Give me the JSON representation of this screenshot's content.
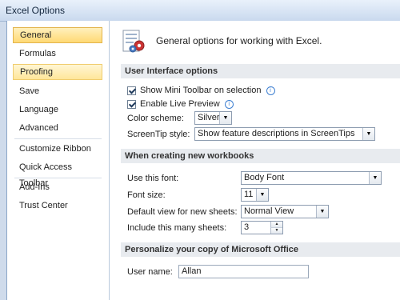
{
  "window": {
    "title": "Excel Options"
  },
  "sidebar": {
    "items": [
      {
        "label": "General"
      },
      {
        "label": "Formulas"
      },
      {
        "label": "Proofing"
      },
      {
        "label": "Save"
      },
      {
        "label": "Language"
      },
      {
        "label": "Advanced"
      },
      {
        "label": "Customize Ribbon"
      },
      {
        "label": "Quick Access Toolbar"
      },
      {
        "label": "Add-Ins"
      },
      {
        "label": "Trust Center"
      }
    ],
    "selected": "General"
  },
  "header": {
    "text": "General options for working with Excel."
  },
  "ui_options": {
    "heading": "User Interface options",
    "mini_toolbar": {
      "label": "Show Mini Toolbar on selection",
      "checked": true
    },
    "live_preview": {
      "label": "Enable Live Preview",
      "checked": true
    },
    "color_scheme": {
      "label": "Color scheme:",
      "value": "Silver"
    },
    "screentip": {
      "label": "ScreenTip style:",
      "value": "Show feature descriptions in ScreenTips"
    }
  },
  "new_workbooks": {
    "heading": "When creating new workbooks",
    "font": {
      "label": "Use this font:",
      "value": "Body Font"
    },
    "font_size": {
      "label": "Font size:",
      "value": "11"
    },
    "default_view": {
      "label": "Default view for new sheets:",
      "value": "Normal View"
    },
    "sheets": {
      "label": "Include this many sheets:",
      "value": "3"
    }
  },
  "personalize": {
    "heading": "Personalize your copy of Microsoft Office",
    "user_name": {
      "label": "User name:",
      "value": "Allan"
    }
  }
}
